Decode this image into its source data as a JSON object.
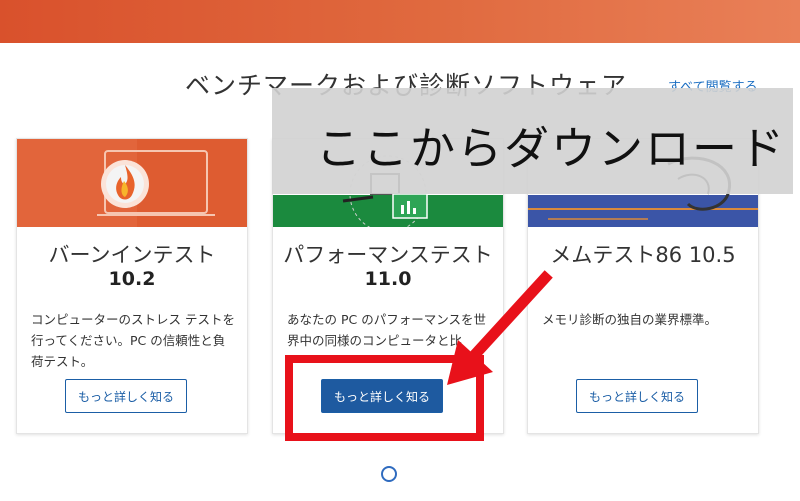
{
  "section": {
    "title": "ベンチマークおよび診断ソフトウェア",
    "view_all": "すべて閲覧する"
  },
  "overlay": {
    "text": "ここからダウンロード",
    "colors": {
      "banner": "#d2d2d2",
      "highlight": "#e8111a"
    }
  },
  "cards": [
    {
      "title": "バーンインテスト",
      "version": "10.2",
      "description": "コンピューターのストレス テストを行ってください。PC の信頼性と負荷テスト。",
      "button": "もっと詳しく知る",
      "image_icon": "flame-laptop-icon"
    },
    {
      "title": "パフォーマンステスト",
      "version": "11.0",
      "description": "あなたの PC のパフォーマンスを世界中の同様のコンピュータと比",
      "button": "もっと詳しく知る",
      "image_icon": "monitor-chart-icon"
    },
    {
      "title": "メムテスト86 10.5",
      "version": "",
      "description": "メモリ診断の独自の業界標準。",
      "button": "もっと詳しく知る",
      "image_icon": "memory-circuit-icon"
    }
  ],
  "colors": {
    "banner": "#d9512c",
    "brand_blue": "#1e5aa0",
    "card1": "#e2653b",
    "card2": "#1b8a3e",
    "card3": "#3b55a7"
  }
}
